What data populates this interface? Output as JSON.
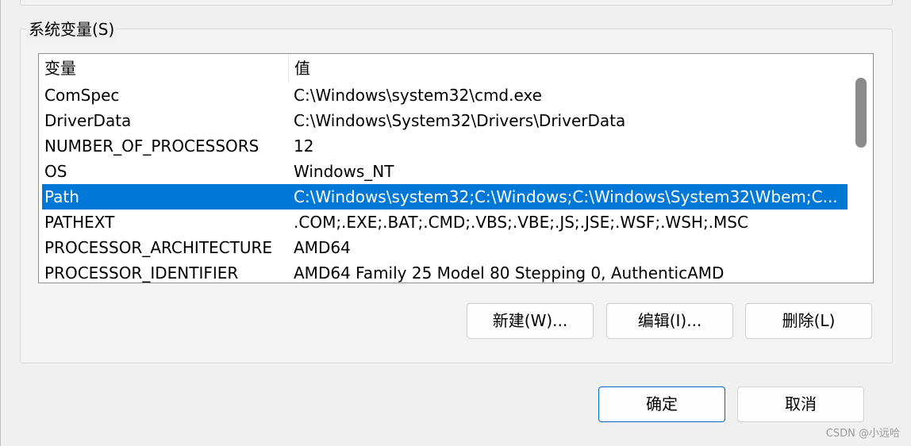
{
  "group_title": "系统变量(S)",
  "list": {
    "columns": {
      "variable": "变量",
      "value": "值"
    },
    "rows": [
      {
        "variable": "ComSpec",
        "value": "C:\\Windows\\system32\\cmd.exe"
      },
      {
        "variable": "DriverData",
        "value": "C:\\Windows\\System32\\Drivers\\DriverData"
      },
      {
        "variable": "NUMBER_OF_PROCESSORS",
        "value": "12"
      },
      {
        "variable": "OS",
        "value": "Windows_NT"
      },
      {
        "variable": "Path",
        "value": "C:\\Windows\\system32;C:\\Windows;C:\\Windows\\System32\\Wbem;C..."
      },
      {
        "variable": "PATHEXT",
        "value": ".COM;.EXE;.BAT;.CMD;.VBS;.VBE;.JS;.JSE;.WSF;.WSH;.MSC"
      },
      {
        "variable": "PROCESSOR_ARCHITECTURE",
        "value": "AMD64"
      },
      {
        "variable": "PROCESSOR_IDENTIFIER",
        "value": "AMD64 Family 25 Model 80 Stepping 0, AuthenticAMD"
      }
    ],
    "selected_row": "Path"
  },
  "buttons": {
    "new": "新建(W)...",
    "edit": "编辑(I)...",
    "delete": "删除(L)",
    "ok": "确定",
    "cancel": "取消"
  },
  "watermark": "CSDN @小远哈",
  "colors": {
    "selection": "#0078d7",
    "default_button_border": "#0067c0"
  }
}
